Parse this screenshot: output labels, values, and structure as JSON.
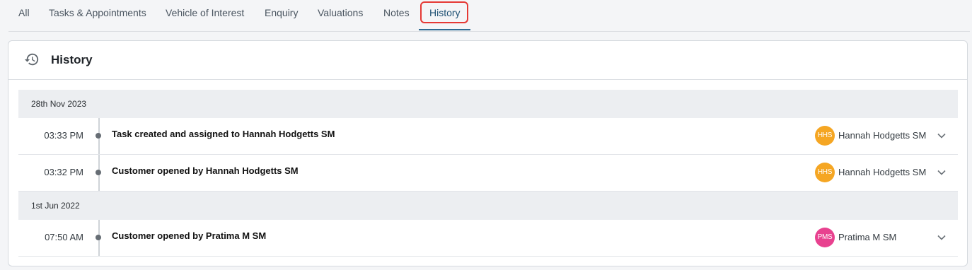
{
  "tabs": [
    {
      "label": "All"
    },
    {
      "label": "Tasks & Appointments"
    },
    {
      "label": "Vehicle of Interest"
    },
    {
      "label": "Enquiry"
    },
    {
      "label": "Valuations"
    },
    {
      "label": "Notes"
    },
    {
      "label": "History"
    }
  ],
  "active_tab": "History",
  "colors": {
    "accent": "#2f6b92",
    "highlight": "#e53935",
    "avatar_orange": "#f5a623",
    "avatar_pink": "#e8418f"
  },
  "card": {
    "title": "History",
    "icon": "history-icon"
  },
  "groups": [
    {
      "date": "28th Nov 2023",
      "entries": [
        {
          "time": "03:33 PM",
          "description": "Task created and assigned to Hannah Hodgetts SM",
          "avatar": "HHS",
          "user": "Hannah Hodgetts SM"
        },
        {
          "time": "03:32 PM",
          "description": "Customer opened by Hannah Hodgetts SM",
          "avatar": "HHS",
          "user": "Hannah Hodgetts SM"
        }
      ]
    },
    {
      "date": "1st Jun 2022",
      "entries": [
        {
          "time": "07:50 AM",
          "description": "Customer opened by Pratima M SM",
          "avatar": "PMS",
          "user": "Pratima M SM"
        }
      ]
    }
  ]
}
